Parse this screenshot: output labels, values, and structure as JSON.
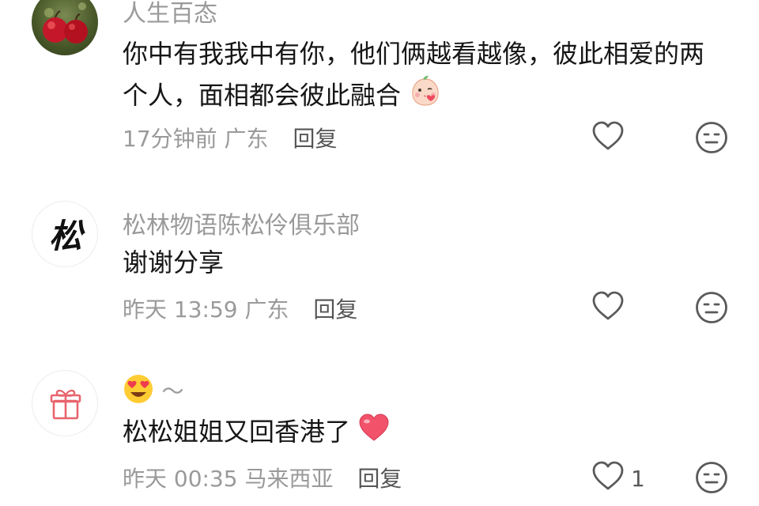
{
  "comments": [
    {
      "username": "人生百态",
      "text_line1": "你中有我我中有你，他们俩越看越像，彼此相爱的两",
      "text_line2": "个人，面相都会彼此融合",
      "time": "17分钟前",
      "location": "广东",
      "reply_label": "回复",
      "avatar_icon": "apples-avatar",
      "emoji_icon": "kissing-bean-emoji"
    },
    {
      "username": "松林物语陈松伶俱乐部",
      "text": "谢谢分享",
      "time": "昨天 13:59",
      "location": "广东",
      "reply_label": "回复",
      "avatar_icon": "pine-calligraphy-avatar",
      "avatar_glyph": "松"
    },
    {
      "username_suffix": "～",
      "text": "松松姐姐又回香港了",
      "time": "昨天 00:35",
      "location": "马来西亚",
      "reply_label": "回复",
      "like_count": "1",
      "avatar_icon": "gift-icon",
      "name_emoji_icon": "heart-eyes-emoji",
      "text_emoji_icon": "red-heart-emoji"
    }
  ],
  "icons": {
    "like": "heart-outline-icon",
    "dislike": "neutral-face-icon"
  },
  "colors": {
    "text": "#161616",
    "secondary": "#9a9a9a",
    "reply": "#555555",
    "icon": "#5a5a5a",
    "heart": "#f2526a"
  }
}
